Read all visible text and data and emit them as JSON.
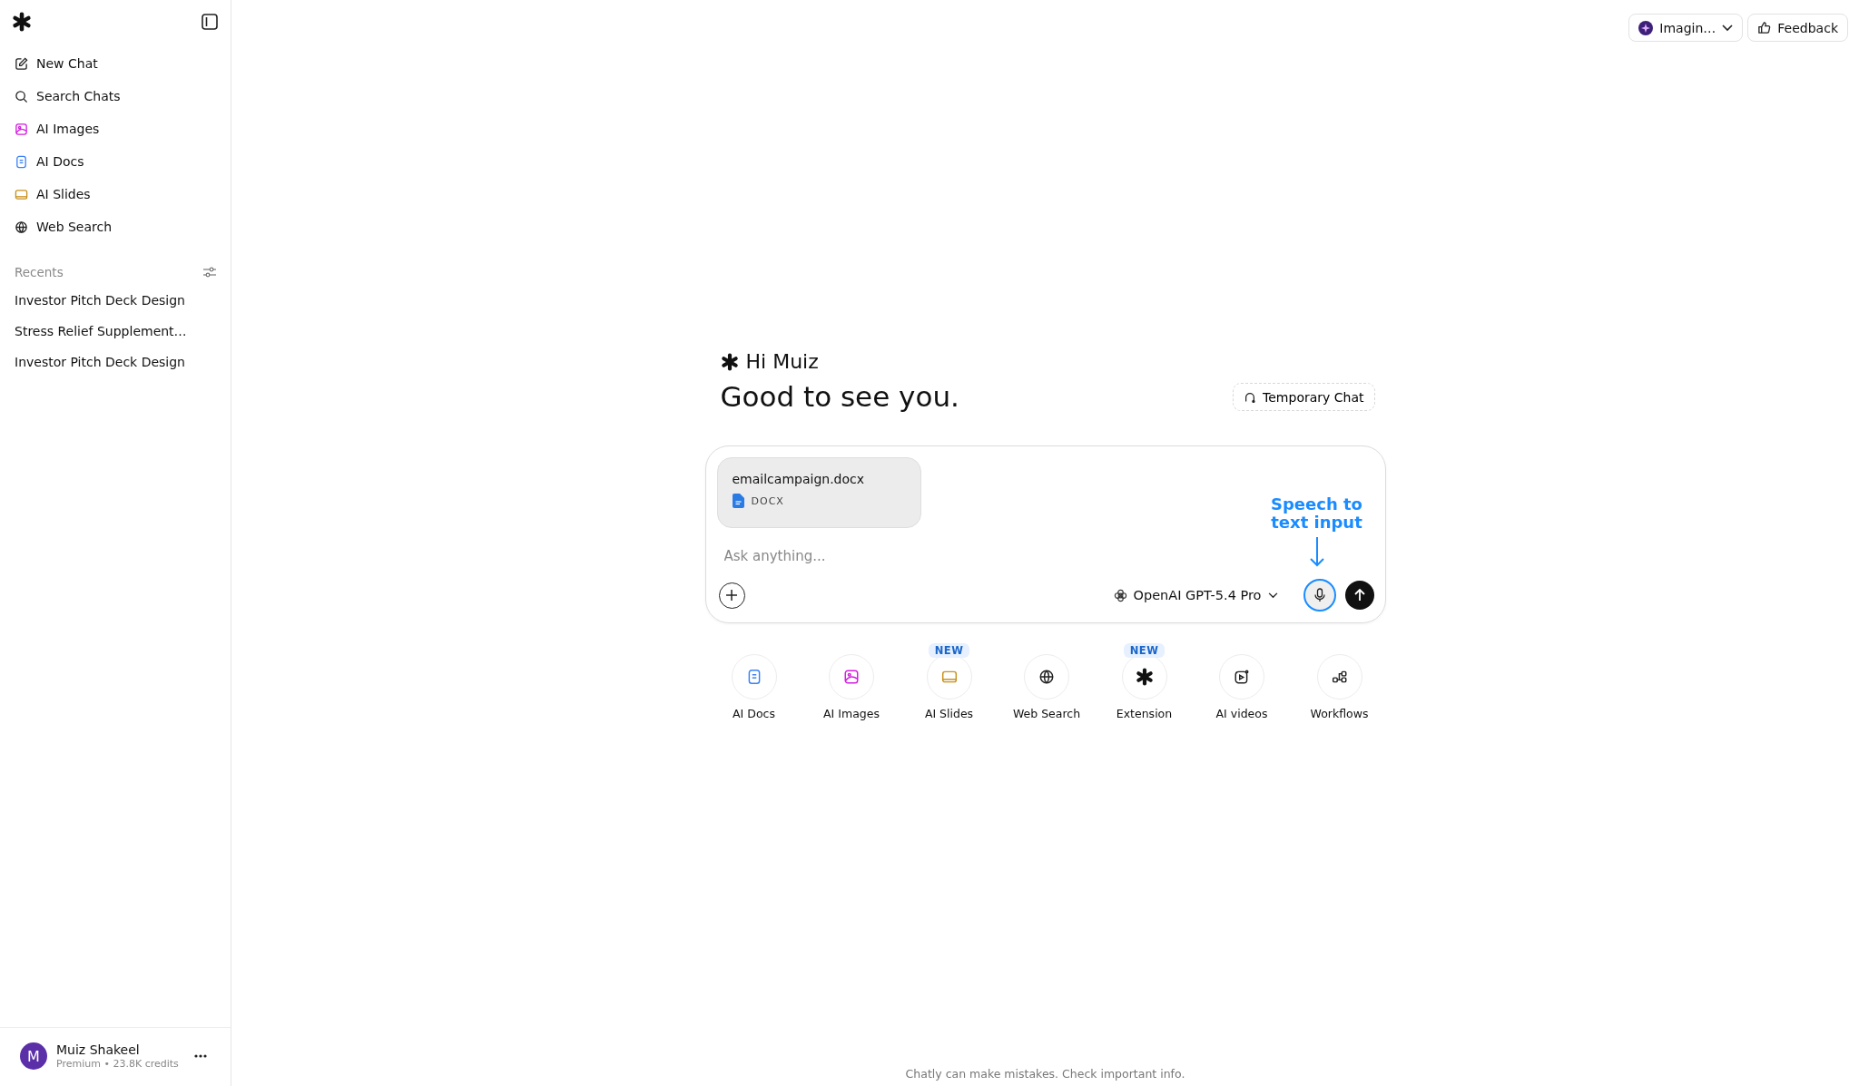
{
  "sidebar": {
    "nav": [
      {
        "kind": "compose",
        "label": "New Chat"
      },
      {
        "kind": "search",
        "label": "Search Chats"
      },
      {
        "kind": "images",
        "label": "AI Images"
      },
      {
        "kind": "docs",
        "label": "AI Docs"
      },
      {
        "kind": "slides",
        "label": "AI Slides"
      },
      {
        "kind": "web",
        "label": "Web Search"
      }
    ],
    "recents_title": "Recents",
    "recents": [
      "Investor Pitch Deck Design",
      "Stress Relief Supplement…",
      "Investor Pitch Deck Design"
    ],
    "user": {
      "initial": "M",
      "name": "Muiz Shakeel",
      "plan": "Premium • 23.8K credits"
    }
  },
  "topbar": {
    "workspace": "Imagin…",
    "feedback": "Feedback"
  },
  "greeting": {
    "hello": "Hi Muiz",
    "title": "Good to see you.",
    "temporary_chat": "Temporary Chat"
  },
  "composer": {
    "attachment": {
      "name": "emailcampaign.docx",
      "type": "DOCX"
    },
    "placeholder": "Ask anything...",
    "model": "OpenAI GPT-5.4 Pro",
    "callout": "Speech to text input"
  },
  "quick_actions": [
    {
      "kind": "docs",
      "label": "AI Docs"
    },
    {
      "kind": "images",
      "label": "AI Images"
    },
    {
      "kind": "slides",
      "label": "AI Slides",
      "badge": "NEW"
    },
    {
      "kind": "web",
      "label": "Web Search"
    },
    {
      "kind": "logo",
      "label": "Extension",
      "badge": "NEW"
    },
    {
      "kind": "video",
      "label": "AI videos"
    },
    {
      "kind": "workflow",
      "label": "Workflows"
    }
  ],
  "footer": "Chatly can make mistakes. Check important info."
}
